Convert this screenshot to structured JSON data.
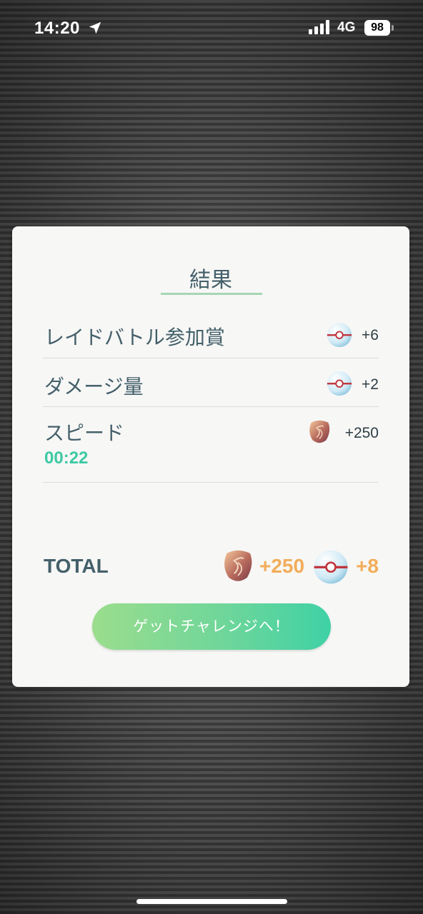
{
  "status_bar": {
    "time": "14:20",
    "network": "4G",
    "battery": "98"
  },
  "results": {
    "title": "結果",
    "rows": [
      {
        "label": "レイドバトル参加賞",
        "icon": "premier-ball-icon",
        "value": "+6"
      },
      {
        "label": "ダメージ量",
        "icon": "premier-ball-icon",
        "value": "+2"
      },
      {
        "label": "スピード",
        "icon": "rare-candy-icon",
        "value": "+250",
        "time": "00:22"
      }
    ],
    "total": {
      "label": "TOTAL",
      "candy_value": "+250",
      "ball_value": "+8"
    },
    "button_label": "ゲットチャレンジへ！"
  },
  "colors": {
    "accent_green": "#3dc9a4",
    "total_orange": "#f2ad5a",
    "text_teal": "#44606a"
  }
}
